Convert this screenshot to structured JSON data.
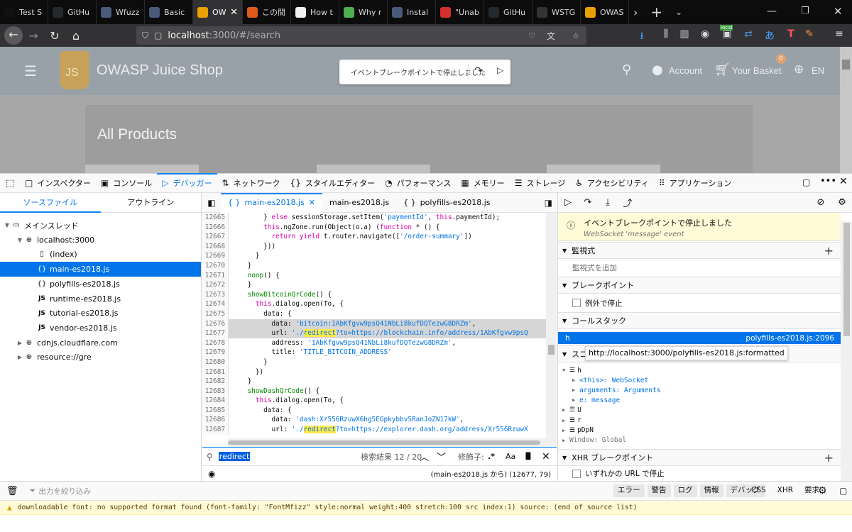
{
  "browser": {
    "tabs": [
      {
        "title": "Test S",
        "color": "#111111"
      },
      {
        "title": "GitHu",
        "color": "#24292e"
      },
      {
        "title": "Wfuzz",
        "color": "#4a5a7a"
      },
      {
        "title": "Basic",
        "color": "#4a5a7a"
      },
      {
        "title": "OW",
        "color": "#e8a100",
        "active": true
      },
      {
        "title": "この間",
        "color": "#e05a1a"
      },
      {
        "title": "How t",
        "color": "#f2f2f2"
      },
      {
        "title": "Why r",
        "color": "#4caf50"
      },
      {
        "title": "Instal",
        "color": "#4a5a7a"
      },
      {
        "title": "\"Unab",
        "color": "#d32f2f"
      },
      {
        "title": "GitHu",
        "color": "#24292e"
      },
      {
        "title": "WSTG",
        "color": "#333333"
      },
      {
        "title": "OWAS",
        "color": "#e8a100"
      }
    ],
    "active_tab_close": "✕",
    "url_host": "localhost",
    "url_rest": ":3000/#/search",
    "localbadge": "local"
  },
  "shop": {
    "logo_text": "JS",
    "title": "OWASP Juice Shop",
    "paused_text": "イベントブレークポイントで停止しました",
    "account": "Account",
    "basket": "Your Basket",
    "basket_count": "0",
    "lang": "EN",
    "products_title": "All Products"
  },
  "devtools": {
    "tabs": [
      {
        "label": "インスペクター",
        "icon": "□"
      },
      {
        "label": "コンソール",
        "icon": "▣"
      },
      {
        "label": "デバッガー",
        "icon": "▷",
        "active": true
      },
      {
        "label": "ネットワーク",
        "icon": "⇅"
      },
      {
        "label": "スタイルエディター",
        "icon": "{}"
      },
      {
        "label": "パフォーマンス",
        "icon": "◔"
      },
      {
        "label": "メモリー",
        "icon": "▦"
      },
      {
        "label": "ストレージ",
        "icon": "☰"
      },
      {
        "label": "アクセシビリティ",
        "icon": "♿"
      },
      {
        "label": "アプリケーション",
        "icon": "⠿"
      }
    ],
    "sources": {
      "tab_sources": "ソースファイル",
      "tab_outline": "アウトライン",
      "tree": [
        {
          "label": "メインスレッド",
          "depth": 0,
          "arrow": "▼",
          "icon": "▭"
        },
        {
          "label": "localhost:3000",
          "depth": 1,
          "arrow": "▼",
          "icon": "⊕"
        },
        {
          "label": "(index)",
          "depth": 2,
          "arrow": "",
          "icon": "▯"
        },
        {
          "label": "main-es2018.js",
          "depth": 2,
          "arrow": "",
          "icon": "{}",
          "selected": true
        },
        {
          "label": "polyfills-es2018.js",
          "depth": 2,
          "arrow": "",
          "icon": "{}"
        },
        {
          "label": "runtime-es2018.js",
          "depth": 2,
          "arrow": "",
          "icon": "JS"
        },
        {
          "label": "tutorial-es2018.js",
          "depth": 2,
          "arrow": "",
          "icon": "JS"
        },
        {
          "label": "vendor-es2018.js",
          "depth": 2,
          "arrow": "",
          "icon": "JS"
        },
        {
          "label": "cdnjs.cloudflare.com",
          "depth": 1,
          "arrow": "▶",
          "icon": "⊕"
        },
        {
          "label": "resource://gre",
          "depth": 1,
          "arrow": "▶",
          "icon": "⊕"
        }
      ]
    },
    "editor": {
      "tabs": [
        {
          "label": "main-es2018.js",
          "icon": "{ }",
          "active": true,
          "close": "✕"
        },
        {
          "label": "main-es2018.js",
          "icon": "",
          "active": false
        },
        {
          "label": "polyfills-es2018.js",
          "icon": "{ }",
          "active": false
        }
      ],
      "lines": [
        {
          "n": "12665",
          "t": "        } else sessionStorage.setItem('paymentId', this.paymentId);"
        },
        {
          "n": "12666",
          "t": "        this.ngZone.run(Object(o.a) (function * () {"
        },
        {
          "n": "12667",
          "t": "          return yield t.router.navigate(['/order-summary'])"
        },
        {
          "n": "12668",
          "t": "        }))"
        },
        {
          "n": "12669",
          "t": "      }"
        },
        {
          "n": "12670",
          "t": "    }"
        },
        {
          "n": "12671",
          "t": "    noop() {"
        },
        {
          "n": "12672",
          "t": "    }"
        },
        {
          "n": "12673",
          "t": "    showBitcoinQrCode() {"
        },
        {
          "n": "12674",
          "t": "      this.dialog.open(To, {"
        },
        {
          "n": "12675",
          "t": "        data: {"
        },
        {
          "n": "12676",
          "t": "          data: 'bitcoin:1AbKfgvw9psQ41NbLi8kufDQTezwG8DRZm',",
          "hl": true
        },
        {
          "n": "12677",
          "t": "          url: './redirect?to=https://blockchain.info/address/1AbKfgvw9psQ",
          "hl": true
        },
        {
          "n": "12678",
          "t": "          address: '1AbKfgvw9psQ41NbLi8kufDQTezwG8DRZm',"
        },
        {
          "n": "12679",
          "t": "          title: 'TITLE_BITCOIN_ADDRESS'"
        },
        {
          "n": "12680",
          "t": "        }"
        },
        {
          "n": "12681",
          "t": "      })"
        },
        {
          "n": "12682",
          "t": "    }"
        },
        {
          "n": "12683",
          "t": "    showDashQrCode() {"
        },
        {
          "n": "12684",
          "t": "      this.dialog.open(To, {"
        },
        {
          "n": "12685",
          "t": "        data: {"
        },
        {
          "n": "12686",
          "t": "          data: 'dash:Xr556RzuwX6hg5EGpkybbv5RanJoZN17kW',"
        },
        {
          "n": "12687",
          "t": "          url: './redirect?to=https://explorer.dash.org/address/Xr556RzuwX"
        }
      ],
      "search_value": "redirect",
      "search_results": "検索結果 12 / 20",
      "modifiers_label": "修飾子:",
      "mod_regex": ".*",
      "mod_case": "Aa",
      "mod_word": "▐▌",
      "footer_location": "(main-es2018.js から)  (12677, 79)"
    },
    "right": {
      "paused_title": "イベントブレークポイントで停止しました",
      "paused_sub": "WebSocket 'message' event",
      "watch_title": "監視式",
      "watch_add": "監視式を追加",
      "breakpoints_title": "ブレークポイント",
      "pause_on_exceptions": "例外で停止",
      "callstack_title": "コールスタック",
      "callstack_fn": "h",
      "callstack_file": "polyfills-es2018.js:2096",
      "scopes_title_partial": "スコ",
      "tooltip": "http://localhost:3000/polyfills-es2018.js:formatted",
      "scopes": [
        {
          "label": "h",
          "depth": 0,
          "arrow": "▼",
          "icon": "☰"
        },
        {
          "label": "<this>: WebSocket",
          "depth": 1,
          "arrow": "▶",
          "blue": true
        },
        {
          "label": "arguments: Arguments",
          "depth": 1,
          "arrow": "▶",
          "blue": true
        },
        {
          "label": "e: message",
          "depth": 1,
          "arrow": "▶",
          "blue": true
        },
        {
          "label": "U",
          "depth": 0,
          "arrow": "▶",
          "icon": "☰"
        },
        {
          "label": "r",
          "depth": 0,
          "arrow": "▶",
          "icon": "☰"
        },
        {
          "label": "pDpN",
          "depth": 0,
          "arrow": "▶",
          "icon": "☰"
        },
        {
          "label": "Window: Global",
          "depth": 0,
          "arrow": "▶",
          "grey": true
        }
      ],
      "xhr_title": "XHR ブレークポイント",
      "xhr_any": "いずれかの URL で停止"
    },
    "console": {
      "filter_placeholder": "出力を絞り込み",
      "levels": [
        "エラー",
        "警告",
        "ログ",
        "情報",
        "デバッグ"
      ],
      "extras": [
        "CSS",
        "XHR",
        "要求"
      ],
      "warning": "downloadable font: no supported format found (font-family: \"FontMfizz\" style:normal weight:400 stretch:100 src index:1) source: (end of source list)"
    }
  }
}
